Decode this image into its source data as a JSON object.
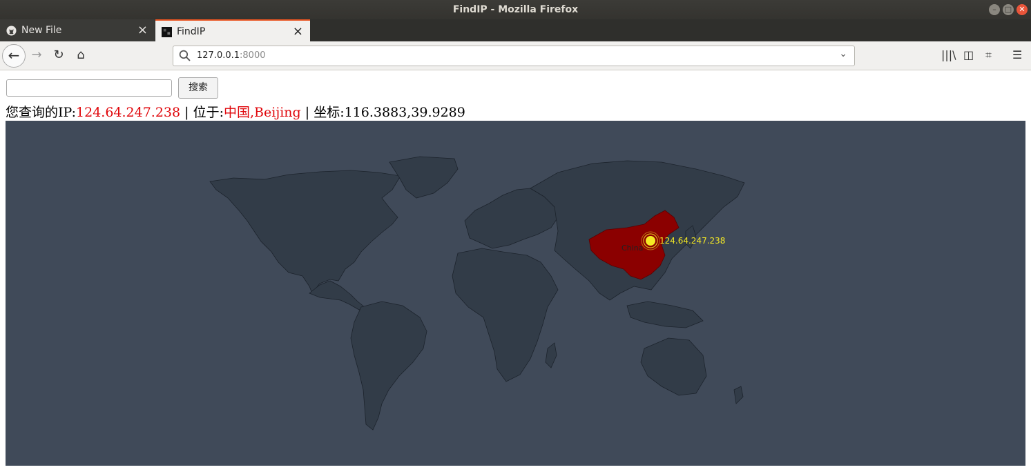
{
  "window": {
    "title": "FindIP - Mozilla Firefox"
  },
  "tabs": [
    {
      "label": "New File",
      "icon": "github-icon",
      "active": false
    },
    {
      "label": "FindIP",
      "icon": "page-icon",
      "active": true
    }
  ],
  "address": {
    "host": "127.0.0.1",
    "port": ":8000"
  },
  "search": {
    "value": "",
    "button_label": "搜索"
  },
  "info": {
    "ip_label": "您查询的IP:",
    "ip_value": "124.64.247.238",
    "sep1": " | ",
    "loc_label": "位于:",
    "loc_value": "中国,Beijing",
    "sep2": " | ",
    "coord_label": "坐标:",
    "coord_value": "116.3883,39.9289"
  },
  "map": {
    "background": "#404a59",
    "land_color": "#323c48",
    "highlight_color": "#8b0000",
    "marker_color": "#f4e925",
    "highlight_label": "China",
    "marker_label": "124.64.247.238",
    "marker_coord": [
      116.3883,
      39.9289
    ]
  }
}
